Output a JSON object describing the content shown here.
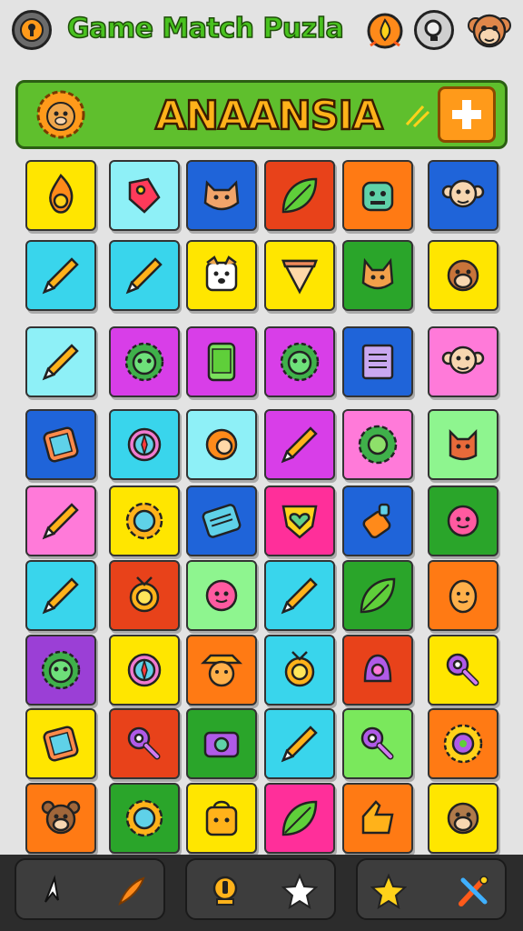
{
  "header": {
    "title": "Game Match Puzla",
    "left_button_icon": "keyhole-icon",
    "right_icons": [
      "fire-badge-icon",
      "magnifier-icon",
      "monkey-avatar-icon"
    ]
  },
  "banner": {
    "text": "ANAANSIA",
    "left_icon": "lion-badge-icon",
    "action_icon": "plus-icon"
  },
  "colors": {
    "yellow": "#ffe600",
    "cyan": "#39d5ec",
    "lightcyan": "#8ef0f7",
    "blue": "#1f64d9",
    "orange": "#ff7a14",
    "red": "#e8421a",
    "green": "#2aa52a",
    "lime": "#7ae85c",
    "mint": "#8ef58f",
    "magenta": "#d83ee8",
    "pink": "#ff7ad9",
    "hotpink": "#ff2f9a",
    "purple": "#9b3fd6"
  },
  "board": {
    "rows": [
      [
        {
          "c": "yellow",
          "icon": "flame-icon"
        },
        {
          "c": "lightcyan",
          "icon": "tag-icon"
        },
        {
          "c": "blue",
          "icon": "cat-face-icon"
        },
        {
          "c": "red",
          "icon": "leaf-icon"
        },
        {
          "c": "orange",
          "icon": "robot-head-icon"
        },
        {
          "c": "blue",
          "icon": "monkey-face-icon"
        }
      ],
      [
        {
          "c": "cyan",
          "icon": "crayon-icon"
        },
        {
          "c": "cyan",
          "icon": "crayon-icon"
        },
        {
          "c": "yellow",
          "icon": "dog-face-icon"
        },
        {
          "c": "yellow",
          "icon": "pizza-slice-icon"
        },
        {
          "c": "green",
          "icon": "fox-icon"
        },
        {
          "c": "yellow",
          "icon": "squirrel-face-icon"
        }
      ],
      [
        {
          "c": "lightcyan",
          "icon": "crayon-icon"
        },
        {
          "c": "magenta",
          "icon": "lion-face-icon"
        },
        {
          "c": "magenta",
          "icon": "tablet-icon"
        },
        {
          "c": "magenta",
          "icon": "lion-face-icon"
        },
        {
          "c": "blue",
          "icon": "notebook-icon"
        },
        {
          "c": "pink",
          "icon": "monkey-face-icon"
        }
      ],
      [
        {
          "c": "blue",
          "icon": "phone-icon"
        },
        {
          "c": "cyan",
          "icon": "compass-icon"
        },
        {
          "c": "lightcyan",
          "icon": "shell-icon"
        },
        {
          "c": "magenta",
          "icon": "crayon-icon"
        },
        {
          "c": "pink",
          "icon": "sun-gear-icon"
        },
        {
          "c": "mint",
          "icon": "fox-face-icon"
        }
      ],
      [
        {
          "c": "pink",
          "icon": "crayon-icon"
        },
        {
          "c": "yellow",
          "icon": "gear-icon"
        },
        {
          "c": "blue",
          "icon": "keyboard-device-icon"
        },
        {
          "c": "hotpink",
          "icon": "shield-heart-icon"
        },
        {
          "c": "blue",
          "icon": "bottle-icon"
        },
        {
          "c": "green",
          "icon": "flower-face-icon"
        }
      ],
      [
        {
          "c": "cyan",
          "icon": "crayon-icon"
        },
        {
          "c": "red",
          "icon": "medal-icon"
        },
        {
          "c": "mint",
          "icon": "flower-face-icon"
        },
        {
          "c": "cyan",
          "icon": "crayon-icon"
        },
        {
          "c": "green",
          "icon": "leaf-icon"
        },
        {
          "c": "orange",
          "icon": "egg-face-icon"
        }
      ],
      [
        {
          "c": "purple",
          "icon": "lion-face-icon"
        },
        {
          "c": "yellow",
          "icon": "compass-icon"
        },
        {
          "c": "orange",
          "icon": "farmer-face-icon"
        },
        {
          "c": "cyan",
          "icon": "medal-icon"
        },
        {
          "c": "red",
          "icon": "bell-icon"
        },
        {
          "c": "yellow",
          "icon": "key-icon"
        }
      ],
      [
        {
          "c": "yellow",
          "icon": "phone-icon"
        },
        {
          "c": "red",
          "icon": "key-icon"
        },
        {
          "c": "green",
          "icon": "camera-icon"
        },
        {
          "c": "cyan",
          "icon": "crayon-icon"
        },
        {
          "c": "lime",
          "icon": "key-icon"
        },
        {
          "c": "orange",
          "icon": "sun-face-icon"
        }
      ],
      [
        {
          "c": "orange",
          "icon": "bear-face-icon"
        },
        {
          "c": "green",
          "icon": "gear-icon"
        },
        {
          "c": "yellow",
          "icon": "backpack-icon"
        },
        {
          "c": "hotpink",
          "icon": "leaf-icon"
        },
        {
          "c": "orange",
          "icon": "thumb-icon"
        },
        {
          "c": "yellow",
          "icon": "otter-face-icon"
        }
      ]
    ]
  },
  "toolbar": {
    "groups": [
      {
        "buttons": [
          "arrow-cursor-icon",
          "feather-icon"
        ]
      },
      {
        "buttons": [
          "trophy-medal-icon",
          "star-outline-icon"
        ]
      },
      {
        "buttons": [
          "star-filled-icon",
          "magic-wand-icon"
        ]
      }
    ]
  }
}
